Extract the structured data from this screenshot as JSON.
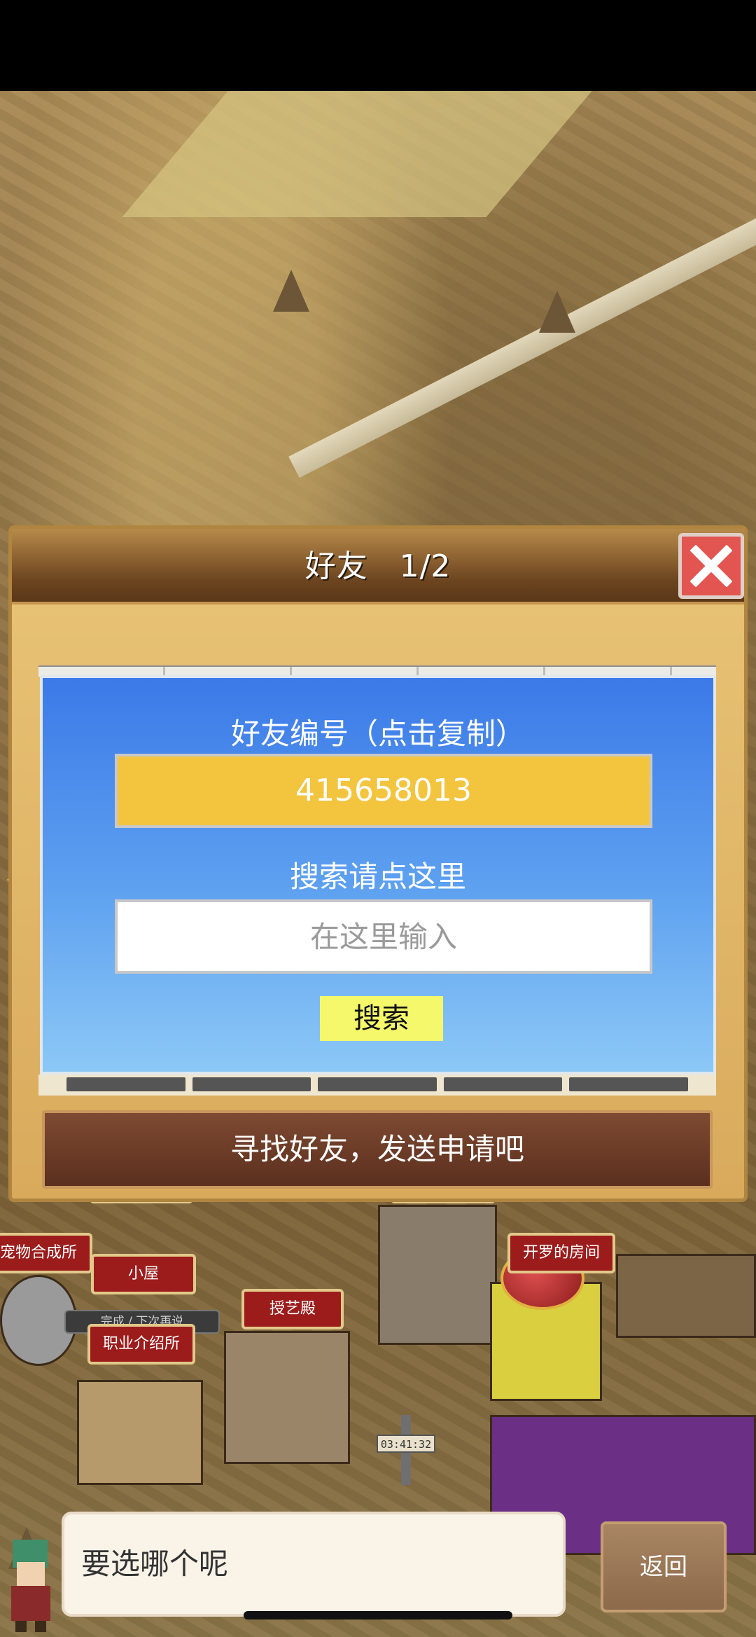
{
  "dialog": {
    "title": "好友　1/2",
    "panel_heading": "好友编号（点击复制）",
    "friend_id": "415658013",
    "search_hint": "搜索请点这里",
    "search_placeholder": "在这里输入",
    "search_button": "搜索",
    "cta": "寻找好友，发送申请吧"
  },
  "town": {
    "labels": [
      "宠物合成所",
      "小屋",
      "授艺殿",
      "开罗的房间",
      "职业介绍所"
    ],
    "ribbon": "完成 / 下次再说",
    "clock": "03:41:32"
  },
  "bottom": {
    "speech": "要选哪个呢",
    "back": "返回"
  },
  "colors": {
    "panel_blue": "#3b7ae8",
    "id_yellow": "#f3c43e",
    "close_red": "#e25550",
    "label_red": "#9c1c1c"
  }
}
